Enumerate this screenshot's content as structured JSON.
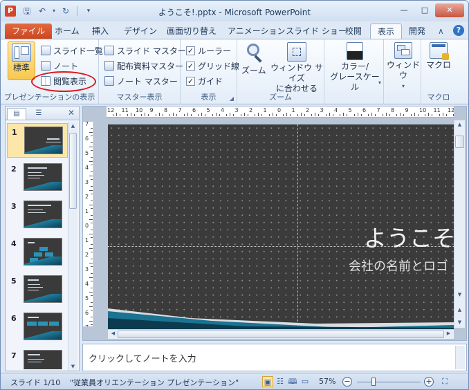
{
  "window": {
    "title": "ようこそ!.pptx - Microsoft PowerPoint"
  },
  "tabs": [
    {
      "label": "ファイル"
    },
    {
      "label": "ホーム"
    },
    {
      "label": "挿入"
    },
    {
      "label": "デザイン"
    },
    {
      "label": "画面切り替え"
    },
    {
      "label": "アニメーション"
    },
    {
      "label": "スライド ショー"
    },
    {
      "label": "校閲"
    },
    {
      "label": "表示"
    },
    {
      "label": "開発"
    }
  ],
  "ribbon": {
    "presentation_views": {
      "label": "プレゼンテーションの表示",
      "normal": "標準",
      "slide_sorter": "スライド一覧",
      "notes": "ノート",
      "reading": "閲覧表示"
    },
    "master_views": {
      "label": "マスター表示",
      "slide_master": "スライド マスター",
      "handout_master": "配布資料マスター",
      "notes_master": "ノート マスター"
    },
    "show": {
      "label": "表示",
      "ruler": "ルーラー",
      "gridlines": "グリッド線",
      "guides": "ガイド",
      "check": "✓"
    },
    "zoom": {
      "label": "ズーム",
      "zoom": "ズーム",
      "fit_line1": "ウィンドウ サイズ",
      "fit_line2": "に合わせる"
    },
    "color": {
      "line1": "カラー/",
      "line2": "グレースケール"
    },
    "window": {
      "label": "ウィンドウ"
    },
    "macro": {
      "label": "マクロ",
      "button": "マクロ"
    }
  },
  "slides_panel": {
    "numbers": [
      "1",
      "2",
      "3",
      "4",
      "5",
      "6",
      "7"
    ],
    "selected": 1
  },
  "slide": {
    "title": "ようこそ!",
    "subtitle": "会社の名前とロゴ"
  },
  "notes": {
    "placeholder": "クリックしてノートを入力"
  },
  "status": {
    "slide_pos": "スライド 1/10",
    "theme": "\"従業員オリエンテーション プレゼンテーション\"",
    "zoom": "57%",
    "zoom_level": 0.57
  },
  "ruler_h_labels": [
    "12",
    "11",
    "10",
    "9",
    "8",
    "7",
    "6",
    "5",
    "4",
    "3",
    "2",
    "1",
    "0",
    "1",
    "2",
    "3",
    "4",
    "5",
    "6",
    "7",
    "8",
    "9",
    "10",
    "11",
    "12"
  ],
  "ruler_v_labels": [
    "7",
    "6",
    "5",
    "4",
    "3",
    "2",
    "1",
    "0",
    "1",
    "2",
    "3",
    "4",
    "5",
    "6",
    "7"
  ]
}
